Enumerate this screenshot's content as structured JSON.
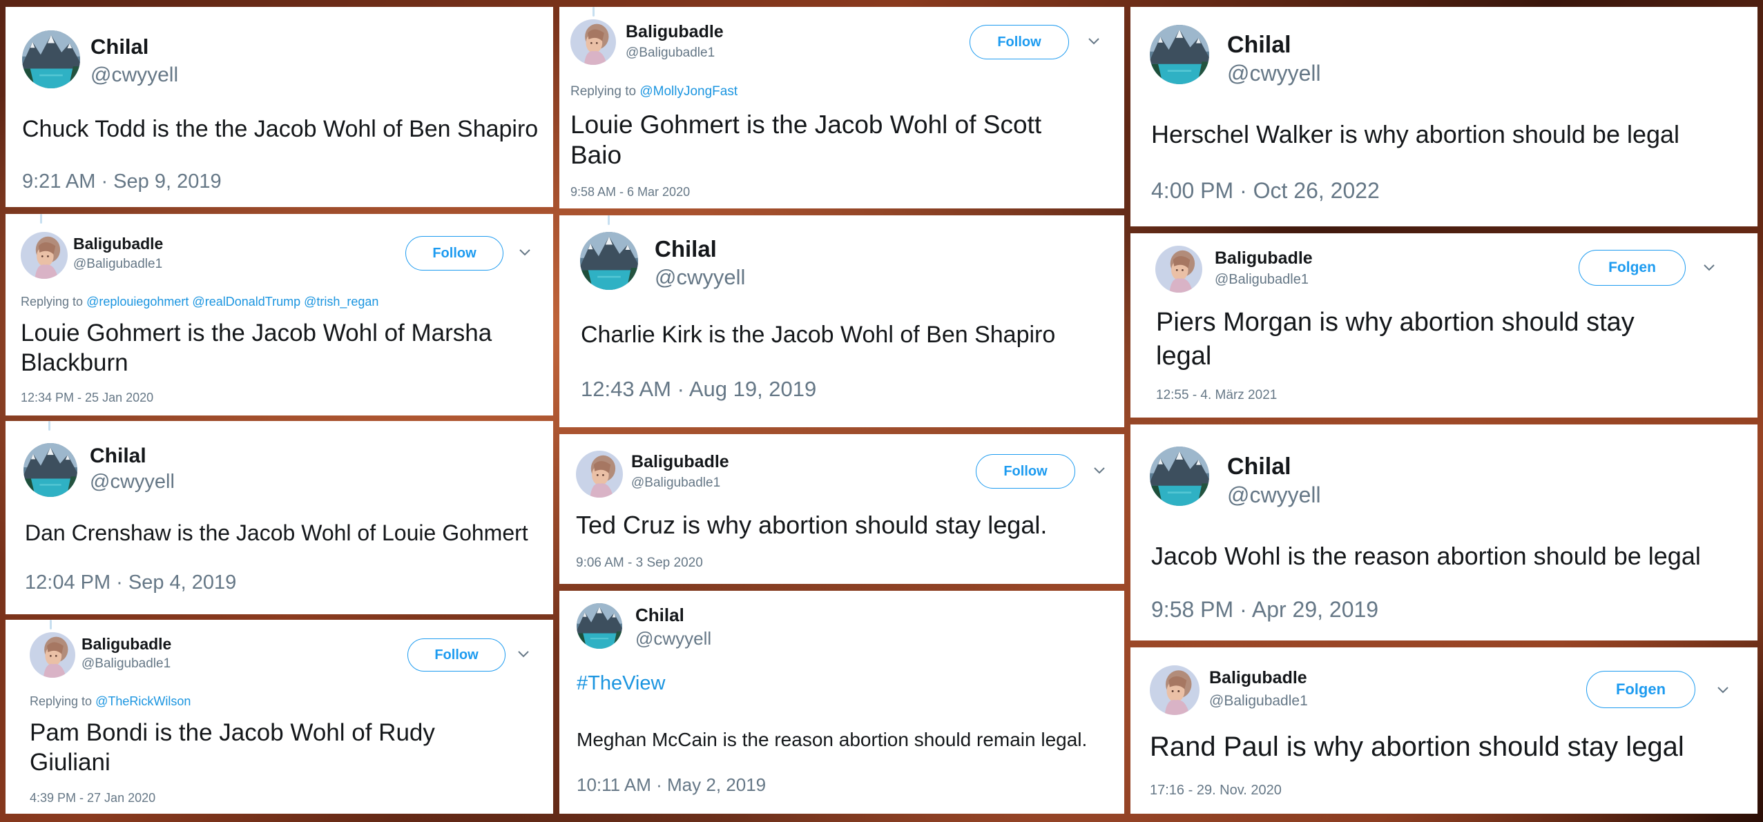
{
  "tweets": [
    {
      "name": "Chilal",
      "handle": "@cwyyell",
      "text": "Chuck Todd is the the Jacob Wohl of Ben Shapiro",
      "time": "9:21 AM · Sep 9, 2019"
    },
    {
      "name": "Baligubadle",
      "handle": "@Baligubadle1",
      "follow": "Follow",
      "replying_label": "Replying to",
      "replying_to": "@replouiegohmert @realDonaldTrump @trish_regan",
      "text1": "Louie Gohmert is the Jacob Wohl of Marsha",
      "text2": "Blackburn",
      "time": "12:34 PM - 25 Jan 2020"
    },
    {
      "name": "Chilal",
      "handle": "@cwyyell",
      "text": "Dan Crenshaw is the Jacob Wohl of Louie Gohmert",
      "time": "12:04 PM · Sep 4, 2019"
    },
    {
      "name": "Baligubadle",
      "handle": "@Baligubadle1",
      "follow": "Follow",
      "replying_label": "Replying to",
      "replying_to": "@TheRickWilson",
      "text1": "Pam Bondi is the Jacob Wohl of Rudy",
      "text2": "Giuliani",
      "time": "4:39 PM - 27 Jan 2020"
    },
    {
      "name": "Baligubadle",
      "handle": "@Baligubadle1",
      "follow": "Follow",
      "replying_label": "Replying to",
      "replying_to": "@MollyJongFast",
      "text1": "Louie Gohmert is the Jacob Wohl of Scott",
      "text2": "Baio",
      "time": "9:58 AM - 6 Mar 2020"
    },
    {
      "name": "Chilal",
      "handle": "@cwyyell",
      "text": "Charlie Kirk is the Jacob Wohl of Ben Shapiro",
      "time": "12:43 AM · Aug 19, 2019"
    },
    {
      "name": "Baligubadle",
      "handle": "@Baligubadle1",
      "follow": "Follow",
      "text": "Ted Cruz is why abortion should stay legal.",
      "time": "9:06 AM - 3 Sep 2020"
    },
    {
      "name": "Chilal",
      "handle": "@cwyyell",
      "hashtag": "#TheView",
      "text": "Meghan McCain is the reason abortion should remain legal.",
      "time": "10:11 AM · May 2, 2019"
    },
    {
      "name": "Chilal",
      "handle": "@cwyyell",
      "text": "Herschel Walker is why abortion should be legal",
      "time": "4:00 PM · Oct 26, 2022"
    },
    {
      "name": "Baligubadle",
      "handle": "@Baligubadle1",
      "follow": "Folgen",
      "text1": "Piers Morgan is why abortion should stay",
      "text2": "legal",
      "time": "12:55 - 4. März 2021"
    },
    {
      "name": "Chilal",
      "handle": "@cwyyell",
      "text": "Jacob Wohl is the reason abortion should be legal",
      "time": "9:58 PM · Apr 29, 2019"
    },
    {
      "name": "Baligubadle",
      "handle": "@Baligubadle1",
      "follow": "Folgen",
      "text": "Rand Paul is why abortion should stay legal",
      "time": "17:16 - 29. Nov. 2020"
    }
  ],
  "icons": {
    "avatar_lake": "mountain-lake-avatar-icon",
    "avatar_person": "person-avatar-icon",
    "chevron": "chevron-down-icon"
  },
  "colors": {
    "link": "#1b95e0",
    "follow": "#1d9bf0",
    "text": "#14171a",
    "secondary": "#657786"
  }
}
